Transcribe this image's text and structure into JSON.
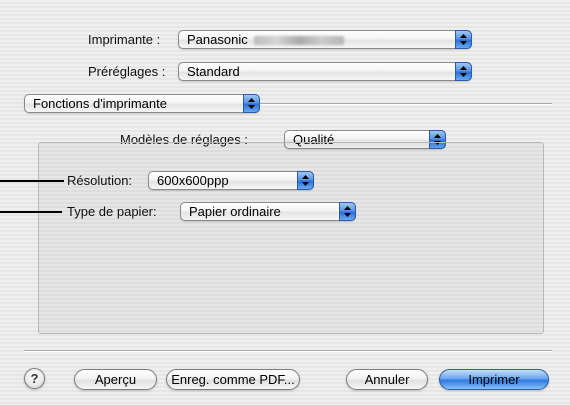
{
  "printer": {
    "label": "Imprimante :",
    "value": "Panasonic"
  },
  "presets": {
    "label": "Préréglages :",
    "value": "Standard"
  },
  "section": {
    "value": "Fonctions d'imprimante"
  },
  "feature_sets": {
    "label": "Modèles de réglages :",
    "value": "Qualité"
  },
  "resolution": {
    "label": "Résolution:",
    "value": "600x600ppp"
  },
  "paper_type": {
    "label": "Type de papier:",
    "value": "Papier ordinaire"
  },
  "buttons": {
    "help": "?",
    "preview": "Aperçu",
    "save_pdf": "Enreg. comme PDF...",
    "cancel": "Annuler",
    "print": "Imprimer"
  }
}
